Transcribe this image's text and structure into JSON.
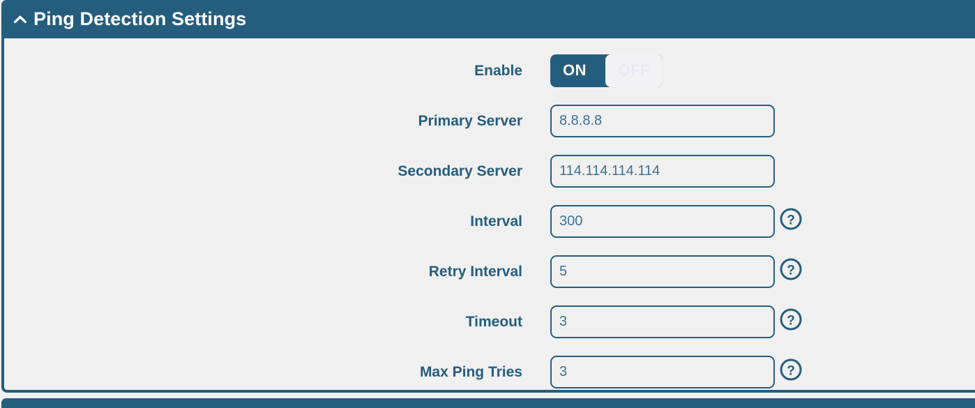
{
  "panel": {
    "title": "Ping Detection Settings",
    "collapse_icon": "chevron-up-icon",
    "header_color": "#255d7e",
    "body_background": "#f0f0f0",
    "label_color": "#255d7e",
    "input_text_color": "#3d7294"
  },
  "form": {
    "rows": [
      {
        "label": "Enable",
        "control": "toggle",
        "on_label": "ON",
        "off_label": "OFF",
        "value": "ON",
        "help": false
      },
      {
        "label": "Primary Server",
        "control": "text",
        "value": "8.8.8.8",
        "placeholder": "",
        "help": false
      },
      {
        "label": "Secondary Server",
        "control": "text",
        "value": "114.114.114.114",
        "placeholder": "",
        "help": false
      },
      {
        "label": "Interval",
        "control": "text",
        "value": "300",
        "placeholder": "",
        "help": true,
        "help_icon": "question-circle-icon"
      },
      {
        "label": "Retry Interval",
        "control": "text",
        "value": "5",
        "placeholder": "",
        "help": true,
        "help_icon": "question-circle-icon"
      },
      {
        "label": "Timeout",
        "control": "text",
        "value": "3",
        "placeholder": "",
        "help": true,
        "help_icon": "question-circle-icon"
      },
      {
        "label": "Max Ping Tries",
        "control": "text",
        "value": "3",
        "placeholder": "",
        "help": true,
        "help_icon": "question-circle-icon"
      }
    ]
  }
}
